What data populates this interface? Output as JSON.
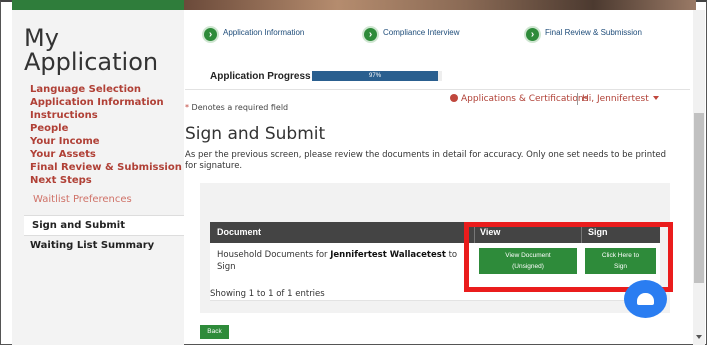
{
  "sidebar": {
    "title_line1": "My",
    "title_line2": "Application",
    "items": [
      {
        "label": "Language Selection"
      },
      {
        "label": "Application Information"
      },
      {
        "label": "Instructions"
      },
      {
        "label": "People"
      },
      {
        "label": "Your Income"
      },
      {
        "label": "Your Assets"
      },
      {
        "label": "Final Review & Submission"
      },
      {
        "label": "Next Steps"
      }
    ],
    "sub_item": "Waitlist Preferences",
    "active_item": "Sign and Submit",
    "last_item": "Waiting List Summary"
  },
  "steps": [
    {
      "label": "Application Information",
      "icon": "chevron-right-icon"
    },
    {
      "label": "Compliance Interview",
      "icon": "chevron-right-icon"
    },
    {
      "label": "Final Review & Submission",
      "icon": "chevron-right-icon"
    }
  ],
  "progress": {
    "label": "Application Progress",
    "value_text": "97%",
    "value": 0.97
  },
  "header_links": {
    "applications": "Applications & Certifications",
    "user": "Hi, Jennifertest"
  },
  "required_note": {
    "star": "*",
    "text": " Denotes a required field"
  },
  "main": {
    "title": "Sign and Submit",
    "description": "As per the previous screen, please review the documents in detail for accuracy. Only one set needs to be printed for signature."
  },
  "table": {
    "columns": [
      "Document",
      "View",
      "Sign"
    ],
    "rows": [
      {
        "doc_prefix": "Household Documents for ",
        "doc_name": "Jennifertest Wallacetest",
        "doc_suffix": " to Sign",
        "view_btn_line1": "View Document",
        "view_btn_line2": "(Unsigned)",
        "sign_btn_line1": "Click Here to",
        "sign_btn_line2": "Sign"
      }
    ],
    "entries_text": "Showing 1 to 1 of 1 entries"
  },
  "back_button": "Back",
  "colors": {
    "accent_green": "#2e8b3a",
    "link_red": "#b04036",
    "progress_blue": "#2a5f8f",
    "highlight_red": "#ea1c1c",
    "chat_blue": "#2a7df1"
  }
}
